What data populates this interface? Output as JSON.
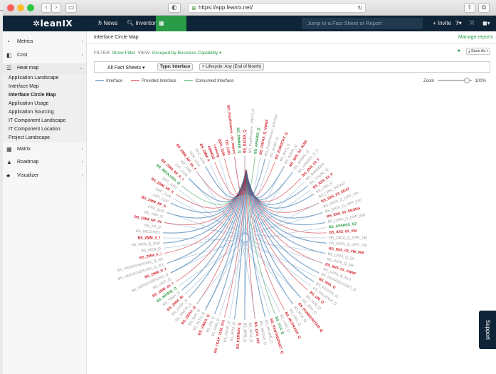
{
  "browser": {
    "url": "https://app.leanix.net/"
  },
  "appnav": {
    "logo": "leanIX",
    "news": "News",
    "inventory": "Inventory",
    "reporting": "Reporting",
    "jump_placeholder": "Jump to a Fact Sheet or Report",
    "invite": "+ Invite"
  },
  "sidebar": {
    "items": [
      {
        "label": "Metrics",
        "icon": "metrics-icon"
      },
      {
        "label": "Cost",
        "icon": "cost-icon"
      },
      {
        "label": "Heat map",
        "icon": "heatmap-icon",
        "open": true
      },
      {
        "label": "Matrix",
        "icon": "matrix-icon"
      },
      {
        "label": "Roadmap",
        "icon": "roadmap-icon"
      },
      {
        "label": "Visualizer",
        "icon": "visualizer-icon"
      }
    ],
    "subitems": [
      {
        "label": "Application Landscape"
      },
      {
        "label": "Interface Map"
      },
      {
        "label": "Interface Circle Map",
        "active": true
      },
      {
        "label": "Application Usage"
      },
      {
        "label": "Application Sourcing"
      },
      {
        "label": "IT Component Landscape"
      },
      {
        "label": "IT Component Location"
      },
      {
        "label": "Project Landscape"
      }
    ]
  },
  "main": {
    "title": "Interface Circle Map",
    "manage_reports": "Manage reports",
    "filter_label": "FILTER:",
    "filter_value": "Show Filter",
    "view_label": "VIEW:",
    "view_value": "Grouped by Business Capability ▾",
    "save_as": "Save As",
    "all_fact_sheets": "All Fact Sheets ▾",
    "chip_type": "Type: Interface",
    "chip_lifecycle": "× Lifecycle: Any (End of Month)",
    "legend": {
      "interface": "Interface",
      "provided": "Provided Interface",
      "consumed": "Consumed Interface",
      "interface_color": "#2f6fa8",
      "provided_color": "#d0202a",
      "consumed_color": "#2a9b47"
    },
    "zoom_label": "Zoom",
    "zoom_value": "100%"
  },
  "circle_labels": {
    "red": [
      "BS_DATAX_Q",
      "BS_DATAX_Q_VWNF",
      "BS_EUROTAX_Q",
      "BS_IDIS_03_AUDI",
      "BS_IDIS_03_F",
      "BS_IDIS_03_P",
      "BS_IDIS_03_SEAT",
      "BS_IDIS_03_SKODA",
      "BS_IDIS_03_VW",
      "BS_IDIS_03_VW_005",
      "BS_IDIS_03_VWNF",
      "BS_IDIS_Q",
      "BS_DM_Q",
      "BS_KUNDENSTAM_Q",
      "BS_MOTRADA_Q",
      "BS_PANTHEON/ET_Q",
      "BS_QF3_300",
      "BS_KERBAV_Q",
      "BS_TEAP_1102_012",
      "BS_VWAG_Q",
      "BS_ZEFIX_Q",
      "BS_ZMM_de",
      "BS_ZMM_de_f",
      "BS_ZMM_fr_f",
      "BS_ZMM_fr_i",
      "BS_ZMM_it_f",
      "BS_ZMM_NF_de",
      "BS_ZMM_NF_fr",
      "BS_ZMM_NF_it",
      "BS_ZMM_NF_fr_f",
      "BS_ZMM_NF_de_f",
      "BS_ZMM_it",
      "GIRNOS",
      "Leasing",
      "QSA_1100",
      "TEI_1100",
      "BO_PostFinance...ter_Import"
    ],
    "green": [
      "BS_APARES_Q",
      "BS_APARES_Q2",
      "BS_TCS_Q",
      "BS_MOBIQ_Q",
      "BS_MEDLUNG_Q",
      "BS_ZIMMER_Q"
    ],
    "gray": [
      "BO_PostFinance...Import_al",
      "BO_PostFinance...Dienstst",
      "BS_ALMA_Q",
      "BS_ANO_Q",
      "BS_AGNA_Q",
      "BS_APARE_Q",
      "BS_APARES_Q_3",
      "BS_BARRERA",
      "BS_CALPE_Q",
      "BS_CBG_Q",
      "BS_CRM_DIENST",
      "BS_DATA_Q_OPP_230",
      "BS_DATA_Q_OPP_310",
      "BS_DATA_Q_OPP_430",
      "BS_DATA_Q_OPP_740",
      "BS_DATA_Q_OPP_760",
      "BS_DATA_Q_QL",
      "BS_DATA_Q_DR",
      "BS_DATA_Q_BLD",
      "BS_FAHRZEUGNET_Q",
      "BS_FASPEX_Q",
      "BS_GALAPER_Q",
      "BS_HUB_Q",
      "BS_JIRA_Q",
      "BS_KOA_Q",
      "BS_LBO_Q",
      "BS_LIVE_Q",
      "BS_MESPE_Q",
      "BS_MESSE_Q",
      "BS_MSO_Q",
      "BS_MPB_Q",
      "BS_MRS_Q",
      "BS_PAGE_Q",
      "BS_PNB_Q",
      "BS_QB_Q",
      "BS_RLTH_Q",
      "BS_SAP_Q",
      "BS_SIMON_Q",
      "BS_STRP_Q",
      "BS_TERA_Q",
      "BS_UNIT_Q",
      "BS_VERSICHERUNG_Q",
      "BS_VERSICHERUNG_Q_ALL",
      "BS_VERSICHERUNG_Q_AB",
      "BS_WEB_Q",
      "BS_WEB_Q_DBE",
      "BS_WECHSEL",
      "BS_XR_Q",
      "BS_YMP_Q",
      "CRF_1100",
      "CRT_1100",
      "DRF_1100",
      "DRT_1100",
      "EXT_1100",
      "INT_1100",
      "ODE_1100",
      "OFS_1100"
    ]
  }
}
